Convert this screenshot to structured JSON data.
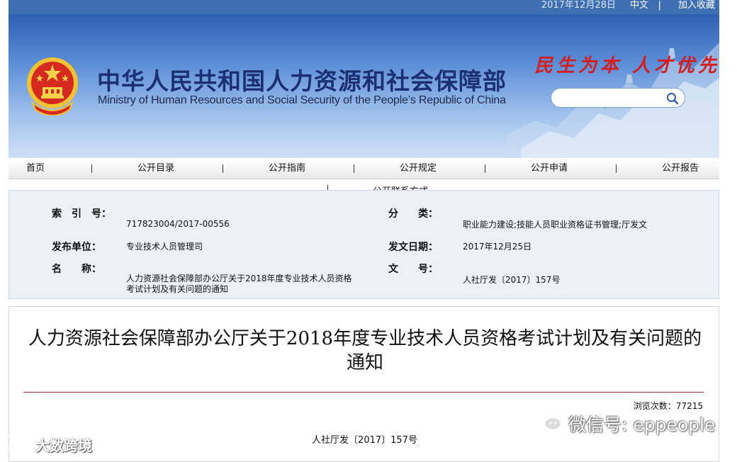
{
  "topbar": {
    "date": "2017年12月28日",
    "lang": "中文",
    "sep": "|",
    "favorite": "加入收藏"
  },
  "header": {
    "title_cn": "中华人民共和国人力资源和社会保障部",
    "title_en": "Ministry of Human Resources and Social Security of the People’s Republic of China",
    "slogan": "民生为本 人才优先",
    "search": {
      "value": "",
      "placeholder": ""
    }
  },
  "nav": {
    "items": [
      "首页",
      "公开目录",
      "公开指南",
      "公开规定",
      "公开申请",
      "公开报告"
    ],
    "overflow_item": "公开联系方式"
  },
  "info": {
    "index_label": "索　引　号：",
    "index_value": "717823004/2017-00556",
    "category_label": "分　　类：",
    "category_value": "职业能力建设;技能人员职业资格证书管理;厅发文",
    "publisher_label": "发布单位：",
    "publisher_value": "专业技术人员管理司",
    "date_label": "发文日期：",
    "date_value": "2017年12月25日",
    "name_label": "名　　称：",
    "name_value": "人力资源社会保障部办公厅关于2018年度专业技术人员资格考试计划及有关问题的通知",
    "docno_label": "文　　号：",
    "docno_value": "人社厅发〔2017〕157号"
  },
  "article": {
    "title": "人力资源社会保障部办公厅关于2018年度专业技术人员资格考试计划及有关问题的通知",
    "views_label": "浏览次数：",
    "views_count": "77215",
    "doc_number": "人社厅发〔2017〕157号"
  },
  "watermarks": {
    "wechat": "微信号: eppeople",
    "brand": "大数跨境"
  },
  "colors": {
    "banner_blue": "#2f5fb0",
    "title_navy": "#1c2f73",
    "slogan_red": "#d51d1d",
    "panel_bg": "#ecf1f8"
  },
  "icons": [
    "national-emblem-icon",
    "search-icon",
    "wechat-icon",
    "brand-logo-icon"
  ]
}
